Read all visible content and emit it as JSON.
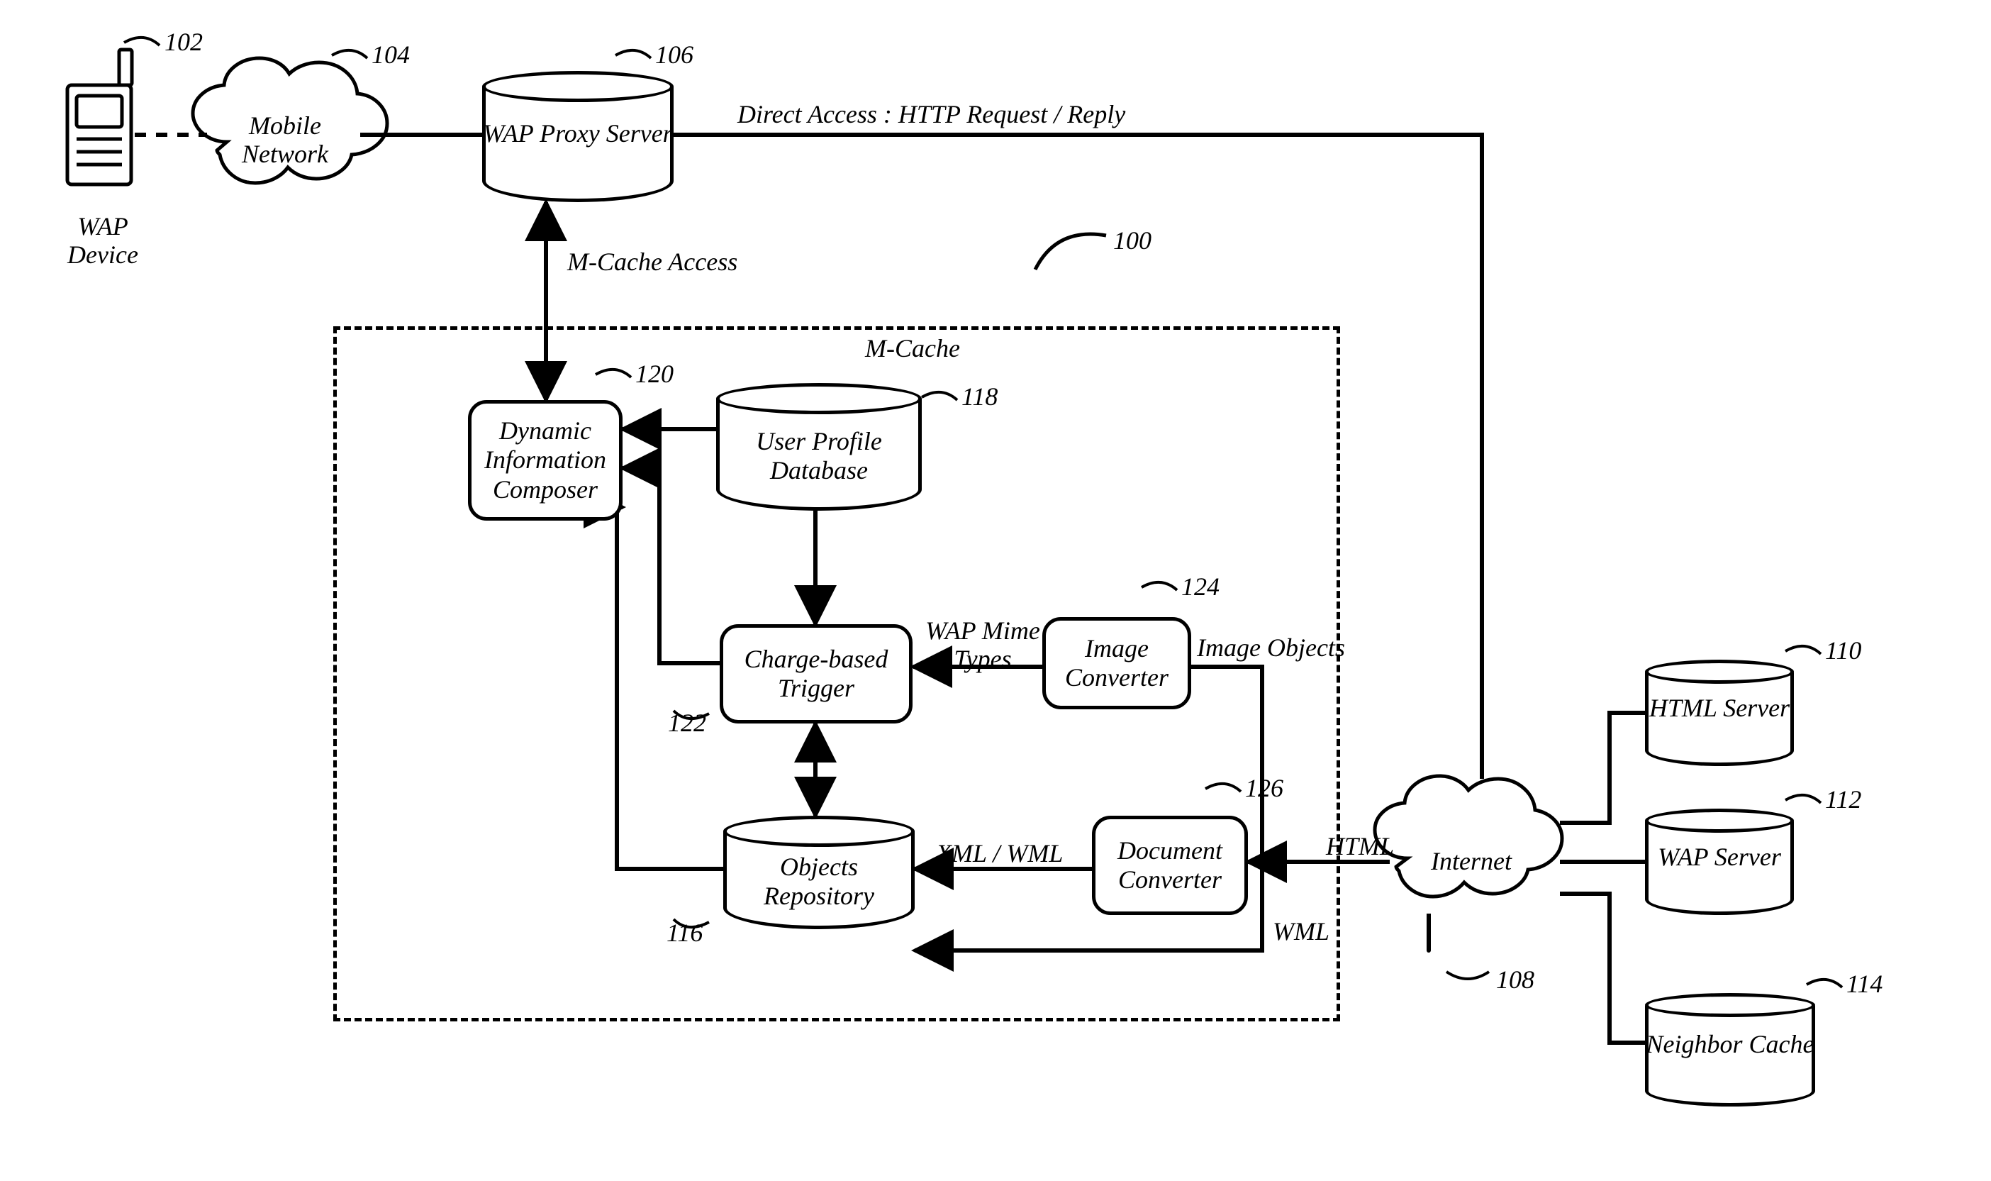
{
  "refs": {
    "r100": "100",
    "r102": "102",
    "r104": "104",
    "r106": "106",
    "r108": "108",
    "r110": "110",
    "r112": "112",
    "r114": "114",
    "r116": "116",
    "r118": "118",
    "r120": "120",
    "r122": "122",
    "r124": "124",
    "r126": "126"
  },
  "labels": {
    "wap_device": "WAP\nDevice",
    "mobile_network": "Mobile\nNetwork",
    "wap_proxy_server": "WAP\nProxy Server",
    "direct_access": "Direct Access : HTTP Request / Reply",
    "m_cache_access": "M-Cache Access",
    "m_cache": "M-Cache",
    "dynamic_info_composer": "Dynamic\nInformation\nComposer",
    "user_profile_db": "User Profile\nDatabase",
    "charge_based_trigger": "Charge-based\nTrigger",
    "image_converter": "Image\nConverter",
    "wap_mime_types": "WAP Mime\nTypes",
    "image_objects": "Image Objects",
    "objects_repository": "Objects\nRepository",
    "document_converter": "Document\nConverter",
    "xml_wml": "XML / WML",
    "html": "HTML",
    "wml": "WML",
    "internet": "Internet",
    "html_server": "HTML\nServer",
    "wap_server": "WAP\nServer",
    "neighbor_cache": "Neighbor\nCache"
  }
}
